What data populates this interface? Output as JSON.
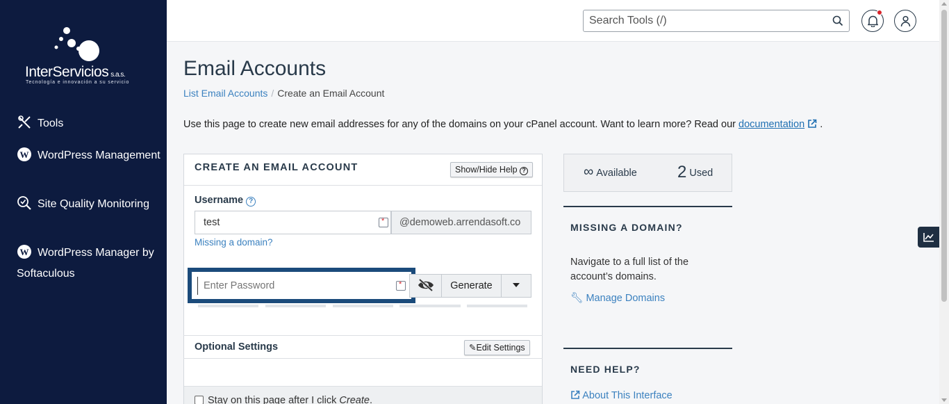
{
  "brand": {
    "name": "InterServicios",
    "suffix": "s.a.s.",
    "tagline": "Tecnología e innovación a su servicio"
  },
  "sidebar": {
    "items": [
      {
        "label": "Tools",
        "icon": "tools-icon"
      },
      {
        "label": "WordPress Management",
        "icon": "wordpress-icon"
      },
      {
        "label": "Site Quality Monitoring",
        "icon": "site-quality-icon"
      },
      {
        "label": "WordPress Manager by Softaculous",
        "icon": "wordpress-icon"
      }
    ]
  },
  "header": {
    "search_placeholder": "Search Tools (/)",
    "notification_icon": "bell-icon",
    "user_icon": "user-icon"
  },
  "page": {
    "title": "Email Accounts",
    "breadcrumb": {
      "parent": "List Email Accounts",
      "current": "Create an Email Account"
    },
    "intro": "Use this page to create new email addresses for any of the domains on your cPanel account. Want to learn more? Read our",
    "intro_link": "documentation",
    "intro_end": "."
  },
  "form": {
    "title": "CREATE AN EMAIL ACCOUNT",
    "help_button": "Show/Hide Help",
    "username_label": "Username",
    "username_value": "test",
    "domain_suffix": "@demoweb.arrendasoft.co",
    "missing_domain_link": "Missing a domain?",
    "password_placeholder": "Enter Password",
    "generate_button": "Generate",
    "optional_settings": "Optional Settings",
    "edit_settings_button": "Edit Settings",
    "stay_label_pre": "Stay on this page after I click ",
    "stay_label_em": "Create",
    "stay_label_post": "."
  },
  "stats": {
    "available_symbol": "∞",
    "available_label": "Available",
    "used_count": "2",
    "used_label": "Used"
  },
  "side": {
    "missing_title": "MISSING A DOMAIN?",
    "missing_text": "Navigate to a full list of the account’s domains.",
    "manage_link": "Manage Domains",
    "help_title": "NEED HELP?",
    "about_link": "About This Interface"
  },
  "colors": {
    "sidebar_bg": "#0d1b3f",
    "link": "#3b81bf",
    "highlight_border": "#1b4b7b",
    "notification_dot": "#d8232a"
  }
}
